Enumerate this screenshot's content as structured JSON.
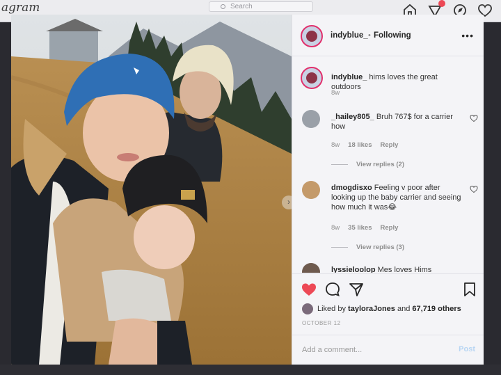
{
  "topbar": {
    "brand": "agram",
    "search_placeholder": "Search",
    "icons": [
      "home-icon",
      "direct-icon",
      "explore-icon",
      "heart-icon"
    ],
    "notification_color": "#ed4956"
  },
  "post": {
    "username": "indyblue_",
    "separator": "•",
    "follow_status": "Following",
    "more": "•••",
    "image_carousel": {
      "dot_count": 9,
      "active_index": 0,
      "next_arrow": "›"
    }
  },
  "comments": [
    {
      "user": "indyblue_",
      "text": "hims loves the great outdoors",
      "age": "8w"
    },
    {
      "user": "_hailey805_",
      "text": "Bruh 767$ for a carrier how",
      "age": "8w",
      "likes": "18 likes",
      "reply": "Reply",
      "view_replies": "View replies (2)"
    },
    {
      "user": "dmogdisxo",
      "text": "Feeling v poor after looking up the baby carrier and seeing how much it was😂",
      "age": "8w",
      "likes": "35 likes",
      "reply": "Reply",
      "view_replies": "View replies (3)"
    },
    {
      "user": "lyssieloolop",
      "text": "Mes loves Hims"
    }
  ],
  "actions": {
    "liked_prefix": "Liked by",
    "liked_user": "tayloraJones",
    "liked_and": "and",
    "liked_others": "67,719 others",
    "date": "OCTOBER 12"
  },
  "comment_box": {
    "placeholder": "Add a comment...",
    "post_label": "Post"
  },
  "colors": {
    "like_red": "#ed4956",
    "link_blue": "#3d9bf0",
    "story_ring": "#e1306c"
  }
}
